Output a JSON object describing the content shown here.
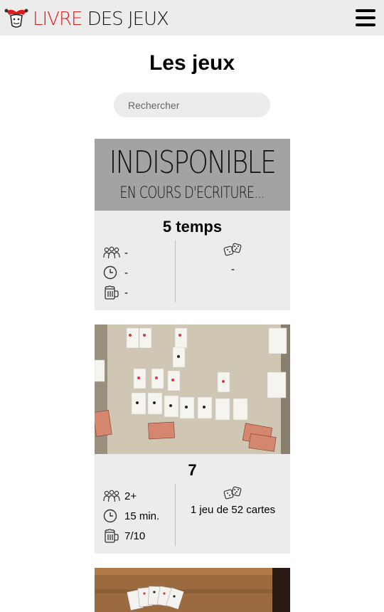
{
  "header": {
    "logo_part1": "LIVRE",
    "logo_part2": " DES JEUX",
    "menu_icon": "hamburger-menu-icon"
  },
  "page": {
    "title": "Les jeux"
  },
  "search": {
    "placeholder": "Rechercher",
    "value": ""
  },
  "games": [
    {
      "name": "5 temps",
      "image_text_main": "INDISPONIBLE",
      "image_text_sub": "EN COURS D'ECRITURE...",
      "players": "-",
      "duration": "-",
      "rating": "-",
      "material": "-"
    },
    {
      "name": "7",
      "players": "2+",
      "duration": "15 min.",
      "rating": "7/10",
      "material": "1 jeu de 52 cartes"
    }
  ],
  "icons": {
    "players": "people-icon",
    "duration": "clock-icon",
    "rating": "beer-mug-icon",
    "material": "dice-icon"
  },
  "colors": {
    "header_bg": "#ececec",
    "logo_accent": "#e01b1b",
    "card_bg": "#ececec",
    "placeholder_bg": "#a3a3a3"
  }
}
